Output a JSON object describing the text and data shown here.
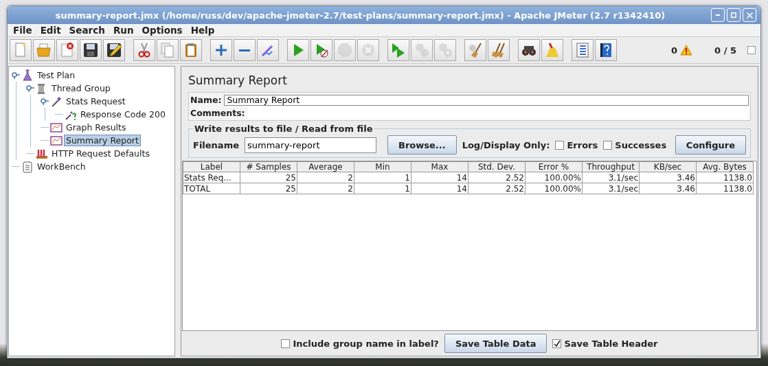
{
  "window": {
    "title": "summary-report.jmx (/home/russ/dev/apache-jmeter-2.7/test-plans/summary-report.jmx) - Apache JMeter (2.7 r1342410)"
  },
  "menu": [
    "File",
    "Edit",
    "Search",
    "Run",
    "Options",
    "Help"
  ],
  "toolbar": [
    {
      "buttons": [
        {
          "kind": "new",
          "disabled": false
        },
        {
          "kind": "open",
          "disabled": false
        },
        {
          "kind": "close",
          "disabled": false
        },
        {
          "kind": "save",
          "disabled": false
        },
        {
          "kind": "saveas",
          "disabled": false
        }
      ]
    },
    {
      "buttons": [
        {
          "kind": "cut",
          "disabled": false
        },
        {
          "kind": "copy",
          "disabled": false
        },
        {
          "kind": "paste",
          "disabled": false
        }
      ]
    },
    {
      "buttons": [
        {
          "kind": "expand",
          "disabled": false
        },
        {
          "kind": "collapse",
          "disabled": false
        },
        {
          "kind": "toggle",
          "disabled": false
        }
      ]
    },
    {
      "buttons": [
        {
          "kind": "start",
          "disabled": false
        },
        {
          "kind": "startnp",
          "disabled": false
        },
        {
          "kind": "stop",
          "disabled": true
        },
        {
          "kind": "shutdown",
          "disabled": true
        }
      ]
    },
    {
      "buttons": [
        {
          "kind": "rstart",
          "disabled": false
        },
        {
          "kind": "rstop",
          "disabled": true
        },
        {
          "kind": "rshutdown",
          "disabled": true
        }
      ]
    },
    {
      "buttons": [
        {
          "kind": "clear",
          "disabled": false
        },
        {
          "kind": "clearall",
          "disabled": false
        }
      ]
    },
    {
      "buttons": [
        {
          "kind": "search",
          "disabled": false
        },
        {
          "kind": "reset",
          "disabled": false
        }
      ]
    },
    {
      "buttons": [
        {
          "kind": "functions",
          "disabled": false
        },
        {
          "kind": "help",
          "disabled": false
        }
      ]
    }
  ],
  "status": {
    "warnings": "0",
    "threads": "0 / 5",
    "checked": false
  },
  "tree": [
    {
      "label": "Test Plan",
      "kind": "plan",
      "selected": false,
      "expanded": true,
      "children": [
        {
          "label": "Thread Group",
          "kind": "threads",
          "selected": false,
          "expanded": true,
          "children": [
            {
              "label": "Stats Request",
              "kind": "sampler",
              "selected": false,
              "expanded": true,
              "children": [
                {
                  "label": "Response Code 200",
                  "kind": "assertion",
                  "selected": false
                }
              ]
            },
            {
              "label": "Graph Results",
              "kind": "listener",
              "selected": false
            },
            {
              "label": "Summary Report",
              "kind": "listener",
              "selected": true
            }
          ]
        },
        {
          "label": "HTTP Request Defaults",
          "kind": "config",
          "selected": false
        }
      ]
    },
    {
      "label": "WorkBench",
      "kind": "workbench",
      "selected": false
    }
  ],
  "report": {
    "title": "Summary Report",
    "name_label": "Name:",
    "name_value": "Summary Report",
    "comments_label": "Comments:",
    "file_group": {
      "title": "Write results to file / Read from file",
      "filename_label": "Filename",
      "filename_value": "summary-report",
      "browse": "Browse...",
      "log_label": "Log/Display Only:",
      "options": [
        {
          "label": "Errors",
          "checked": false
        },
        {
          "label": "Successes",
          "checked": false
        }
      ],
      "configure": "Configure"
    },
    "table": {
      "columns": [
        "Label",
        "# Samples",
        "Average",
        "Min",
        "Max",
        "Std. Dev.",
        "Error %",
        "Throughput",
        "KB/sec",
        "Avg. Bytes"
      ],
      "rows": [
        [
          "Stats Req...",
          "25",
          "2",
          "1",
          "14",
          "2.52",
          "100.00%",
          "3.1/sec",
          "3.46",
          "1138.0"
        ],
        [
          "TOTAL",
          "25",
          "2",
          "1",
          "14",
          "2.52",
          "100.00%",
          "3.1/sec",
          "3.46",
          "1138.0"
        ]
      ]
    },
    "footer": {
      "include_group": {
        "label": "Include group name in label?",
        "checked": false
      },
      "save_data": "Save Table Data",
      "save_header": {
        "label": "Save Table Header",
        "checked": true
      }
    }
  }
}
